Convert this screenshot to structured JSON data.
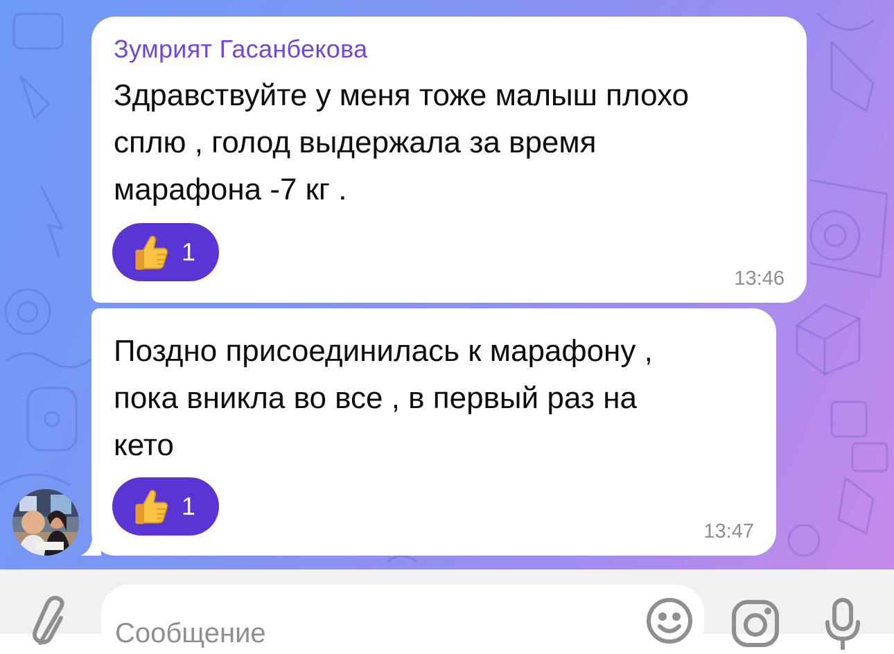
{
  "chat": {
    "messages": [
      {
        "sender": "Зумрият Гасанбекова",
        "text": "Здравствуйте у меня тоже малыш плохо\nсплю , голод выдержала за время\nмарафона -7 кг .",
        "reaction": {
          "emoji": "thumbs-up-icon",
          "count": "1"
        },
        "time": "13:46"
      },
      {
        "text": "Поздно присоединилась к марафону ,\nпока вникла во все , в первый раз на\nкето",
        "reaction": {
          "emoji": "thumbs-up-icon",
          "count": "1"
        },
        "time": "13:47"
      }
    ]
  },
  "composer": {
    "placeholder": "Сообщение",
    "icons": [
      "paperclip-icon",
      "emoji-icon",
      "camera-icon",
      "microphone-icon"
    ]
  },
  "colors": {
    "sender_name": "#7047dd",
    "reaction_bg": "#5b34d4",
    "bubble_bg": "#ffffff",
    "timestamp": "#8d8d92",
    "input_bar_bg": "#f1f1f4"
  }
}
